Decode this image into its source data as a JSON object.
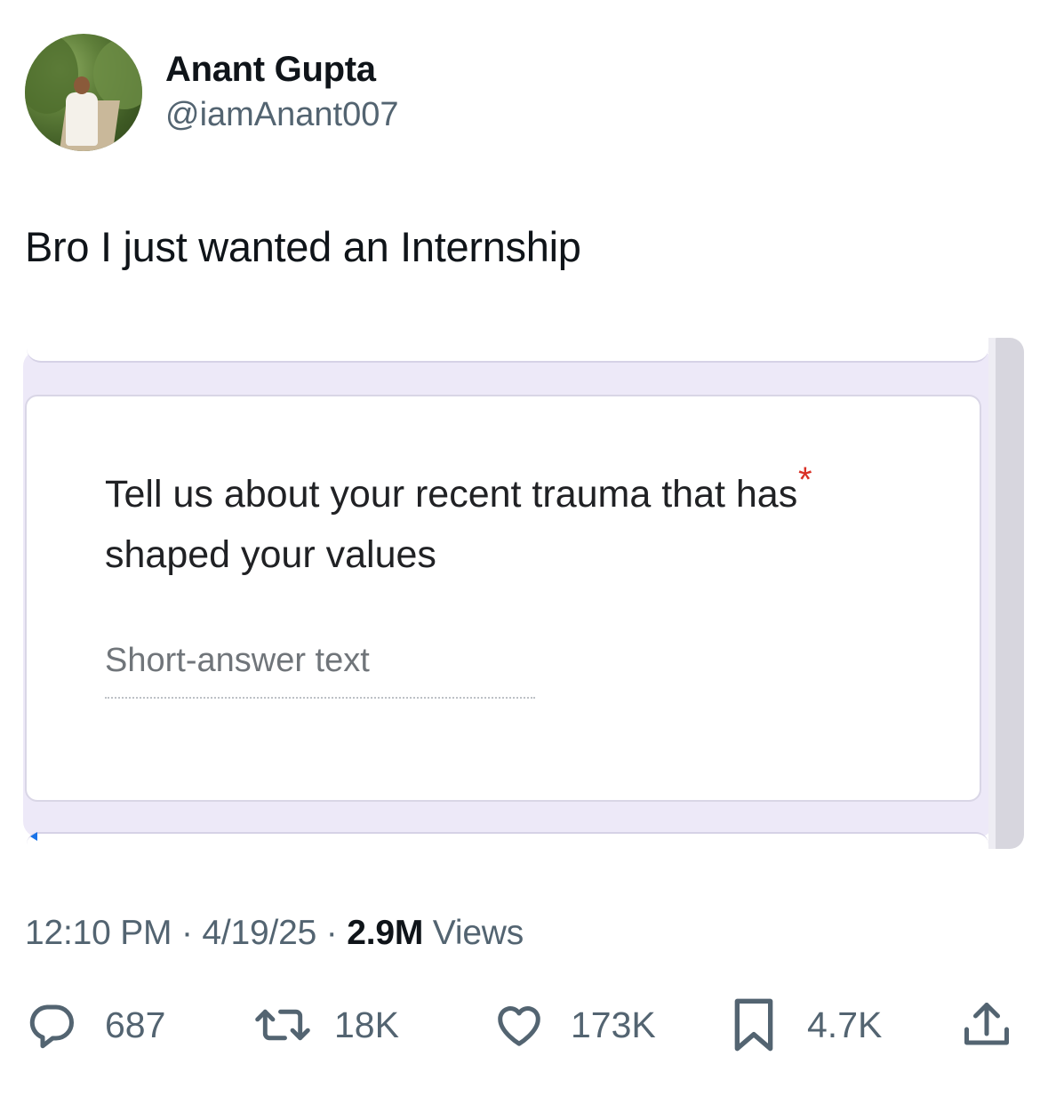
{
  "author": {
    "display_name": "Anant Gupta",
    "handle": "@iamAnant007"
  },
  "tweet": {
    "text": "Bro I just wanted an Internship"
  },
  "form": {
    "question": "Tell us about your recent trauma that has shaped your values",
    "required_mark": "*",
    "answer_placeholder": "Short-answer text"
  },
  "meta": {
    "time": "12:10 PM",
    "sep1": " · ",
    "date": "4/19/25",
    "sep2": " · ",
    "views_count": "2.9M",
    "views_label": " Views"
  },
  "actions": {
    "replies": "687",
    "reposts": "18K",
    "likes": "173K",
    "bookmarks": "4.7K"
  },
  "icons": [
    "reply-icon",
    "repost-icon",
    "like-icon",
    "bookmark-icon",
    "share-icon"
  ],
  "colors": {
    "text_primary": "#0f1419",
    "text_secondary": "#536471",
    "form_background": "#ede9f8",
    "required": "#d93025"
  }
}
